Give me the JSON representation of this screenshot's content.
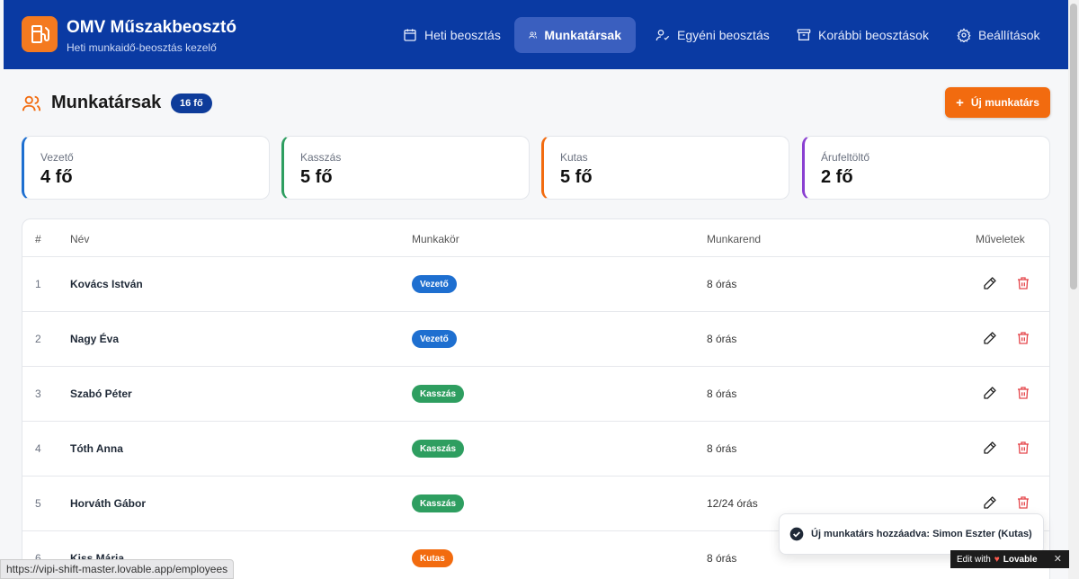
{
  "app": {
    "title": "OMV Műszakbeosztó",
    "subtitle": "Heti munkaidő-beosztás kezelő",
    "brand_color": "#0a3aa3",
    "accent_color": "#f26b0f"
  },
  "nav": [
    {
      "label": "Heti beosztás",
      "icon": "calendar-icon"
    },
    {
      "label": "Munkatársak",
      "icon": "users-icon",
      "active": true
    },
    {
      "label": "Egyéni beosztás",
      "icon": "user-check-icon"
    },
    {
      "label": "Korábbi beosztások",
      "icon": "archive-icon"
    },
    {
      "label": "Beállítások",
      "icon": "gear-icon"
    }
  ],
  "page": {
    "title": "Munkatársak",
    "count_badge": "16 fő",
    "add_button": "Új munkatárs"
  },
  "stats": [
    {
      "label": "Vezető",
      "value": "4 fő",
      "color": "#1e6fd0"
    },
    {
      "label": "Kasszás",
      "value": "5 fő",
      "color": "#2e9e60"
    },
    {
      "label": "Kutas",
      "value": "5 fő",
      "color": "#f26b0f"
    },
    {
      "label": "Árufeltöltő",
      "value": "2 fő",
      "color": "#8a3fd1"
    }
  ],
  "table": {
    "headers": [
      "#",
      "Név",
      "Munkakör",
      "Munkarend",
      "Műveletek"
    ],
    "rows": [
      {
        "num": "1",
        "name": "Kovács István",
        "role": "Vezető",
        "role_color": "#1e6fd0",
        "schedule": "8 órás"
      },
      {
        "num": "2",
        "name": "Nagy Éva",
        "role": "Vezető",
        "role_color": "#1e6fd0",
        "schedule": "8 órás"
      },
      {
        "num": "3",
        "name": "Szabó Péter",
        "role": "Kasszás",
        "role_color": "#2e9e60",
        "schedule": "8 órás"
      },
      {
        "num": "4",
        "name": "Tóth Anna",
        "role": "Kasszás",
        "role_color": "#2e9e60",
        "schedule": "8 órás"
      },
      {
        "num": "5",
        "name": "Horváth Gábor",
        "role": "Kasszás",
        "role_color": "#2e9e60",
        "schedule": "12/24 órás"
      },
      {
        "num": "6",
        "name": "Kiss Mária",
        "role": "Kutas",
        "role_color": "#f26b0f",
        "schedule": "8 órás"
      }
    ]
  },
  "toast": {
    "message": "Új munkatárs hozzáadva: Simon Eszter (Kutas)"
  },
  "status_url": "https://vipi-shift-master.lovable.app/employees",
  "lovable": {
    "label": "Edit with",
    "brand": "Lovable",
    "close": "✕"
  }
}
